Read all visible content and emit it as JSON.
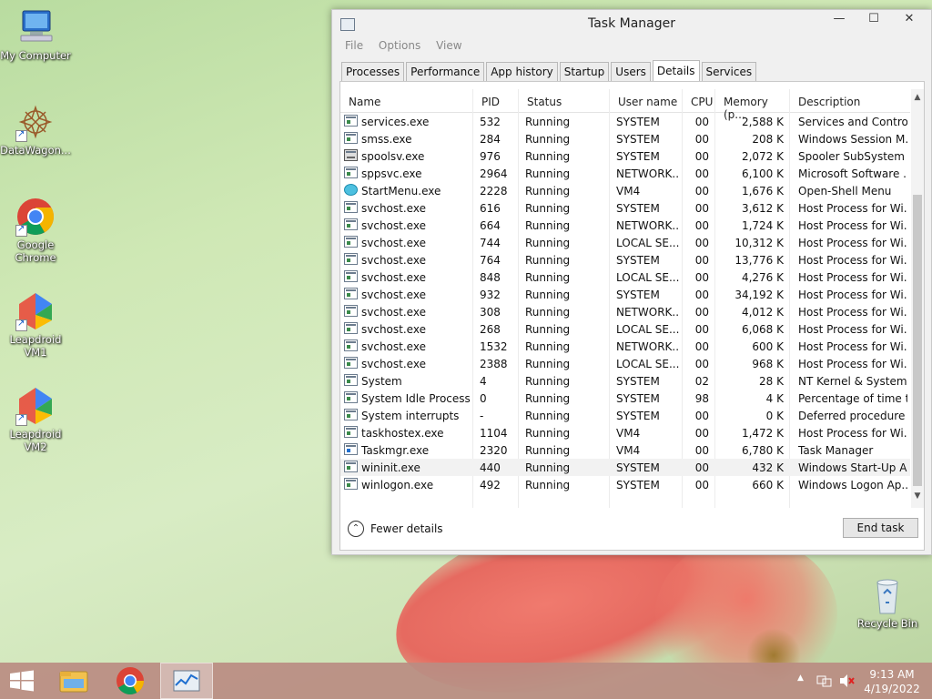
{
  "desktop": {
    "icons": [
      {
        "label": "My Computer",
        "icon": "computer-icon"
      },
      {
        "label": "DataWagon...",
        "icon": "datawagon-icon"
      },
      {
        "label": "Google Chrome",
        "icon": "chrome-icon"
      },
      {
        "label": "Leapdroid VM1",
        "icon": "leapdroid-icon"
      },
      {
        "label": "Leapdroid VM2",
        "icon": "leapdroid-icon"
      },
      {
        "label": "Recycle Bin",
        "icon": "recycle-bin-icon"
      }
    ]
  },
  "window": {
    "title": "Task Manager",
    "controls": {
      "minimize": "—",
      "maximize": "☐",
      "close": "✕"
    },
    "menu": [
      "File",
      "Options",
      "View"
    ],
    "tabs": [
      "Processes",
      "Performance",
      "App history",
      "Startup",
      "Users",
      "Details",
      "Services"
    ],
    "active_tab": "Details",
    "columns": [
      "Name",
      "PID",
      "Status",
      "User name",
      "CPU",
      "Memory (p...",
      "Description"
    ],
    "rows": [
      {
        "name": "services.exe",
        "pid": "532",
        "status": "Running",
        "user": "SYSTEM",
        "cpu": "00",
        "mem": "2,588 K",
        "desc": "Services and Control...",
        "icon": "app"
      },
      {
        "name": "smss.exe",
        "pid": "284",
        "status": "Running",
        "user": "SYSTEM",
        "cpu": "00",
        "mem": "208 K",
        "desc": "Windows Session M...",
        "icon": "app"
      },
      {
        "name": "spoolsv.exe",
        "pid": "976",
        "status": "Running",
        "user": "SYSTEM",
        "cpu": "00",
        "mem": "2,072 K",
        "desc": "Spooler SubSystem ...",
        "icon": "printer"
      },
      {
        "name": "sppsvc.exe",
        "pid": "2964",
        "status": "Running",
        "user": "NETWORK...",
        "cpu": "00",
        "mem": "6,100 K",
        "desc": "Microsoft Software ...",
        "icon": "app"
      },
      {
        "name": "StartMenu.exe",
        "pid": "2228",
        "status": "Running",
        "user": "VM4",
        "cpu": "00",
        "mem": "1,676 K",
        "desc": "Open-Shell Menu",
        "icon": "globe"
      },
      {
        "name": "svchost.exe",
        "pid": "616",
        "status": "Running",
        "user": "SYSTEM",
        "cpu": "00",
        "mem": "3,612 K",
        "desc": "Host Process for Wi...",
        "icon": "app"
      },
      {
        "name": "svchost.exe",
        "pid": "664",
        "status": "Running",
        "user": "NETWORK...",
        "cpu": "00",
        "mem": "1,724 K",
        "desc": "Host Process for Wi...",
        "icon": "app"
      },
      {
        "name": "svchost.exe",
        "pid": "744",
        "status": "Running",
        "user": "LOCAL SE...",
        "cpu": "00",
        "mem": "10,312 K",
        "desc": "Host Process for Wi...",
        "icon": "app"
      },
      {
        "name": "svchost.exe",
        "pid": "764",
        "status": "Running",
        "user": "SYSTEM",
        "cpu": "00",
        "mem": "13,776 K",
        "desc": "Host Process for Wi...",
        "icon": "app"
      },
      {
        "name": "svchost.exe",
        "pid": "848",
        "status": "Running",
        "user": "LOCAL SE...",
        "cpu": "00",
        "mem": "4,276 K",
        "desc": "Host Process for Wi...",
        "icon": "app"
      },
      {
        "name": "svchost.exe",
        "pid": "932",
        "status": "Running",
        "user": "SYSTEM",
        "cpu": "00",
        "mem": "34,192 K",
        "desc": "Host Process for Wi...",
        "icon": "app"
      },
      {
        "name": "svchost.exe",
        "pid": "308",
        "status": "Running",
        "user": "NETWORK...",
        "cpu": "00",
        "mem": "4,012 K",
        "desc": "Host Process for Wi...",
        "icon": "app"
      },
      {
        "name": "svchost.exe",
        "pid": "268",
        "status": "Running",
        "user": "LOCAL SE...",
        "cpu": "00",
        "mem": "6,068 K",
        "desc": "Host Process for Wi...",
        "icon": "app"
      },
      {
        "name": "svchost.exe",
        "pid": "1532",
        "status": "Running",
        "user": "NETWORK...",
        "cpu": "00",
        "mem": "600 K",
        "desc": "Host Process for Wi...",
        "icon": "app"
      },
      {
        "name": "svchost.exe",
        "pid": "2388",
        "status": "Running",
        "user": "LOCAL SE...",
        "cpu": "00",
        "mem": "968 K",
        "desc": "Host Process for Wi...",
        "icon": "app"
      },
      {
        "name": "System",
        "pid": "4",
        "status": "Running",
        "user": "SYSTEM",
        "cpu": "02",
        "mem": "28 K",
        "desc": "NT Kernel & System",
        "icon": "app"
      },
      {
        "name": "System Idle Process",
        "pid": "0",
        "status": "Running",
        "user": "SYSTEM",
        "cpu": "98",
        "mem": "4 K",
        "desc": "Percentage of time t...",
        "icon": "app"
      },
      {
        "name": "System interrupts",
        "pid": "-",
        "status": "Running",
        "user": "SYSTEM",
        "cpu": "00",
        "mem": "0 K",
        "desc": "Deferred procedure ...",
        "icon": "app"
      },
      {
        "name": "taskhostex.exe",
        "pid": "1104",
        "status": "Running",
        "user": "VM4",
        "cpu": "00",
        "mem": "1,472 K",
        "desc": "Host Process for Wi...",
        "icon": "app"
      },
      {
        "name": "Taskmgr.exe",
        "pid": "2320",
        "status": "Running",
        "user": "VM4",
        "cpu": "00",
        "mem": "6,780 K",
        "desc": "Task Manager",
        "icon": "tm"
      },
      {
        "name": "wininit.exe",
        "pid": "440",
        "status": "Running",
        "user": "SYSTEM",
        "cpu": "00",
        "mem": "432 K",
        "desc": "Windows Start-Up A...",
        "icon": "app",
        "selected": true
      },
      {
        "name": "winlogon.exe",
        "pid": "492",
        "status": "Running",
        "user": "SYSTEM",
        "cpu": "00",
        "mem": "660 K",
        "desc": "Windows Logon Ap...",
        "icon": "app"
      }
    ],
    "fewer_details": "Fewer details",
    "end_task": "End task"
  },
  "taskbar": {
    "start_icon": "windows-start-icon",
    "apps": [
      "file-explorer-icon",
      "chrome-icon",
      "task-manager-icon"
    ],
    "clock_time": "9:13 AM",
    "clock_date": "4/19/2022"
  }
}
